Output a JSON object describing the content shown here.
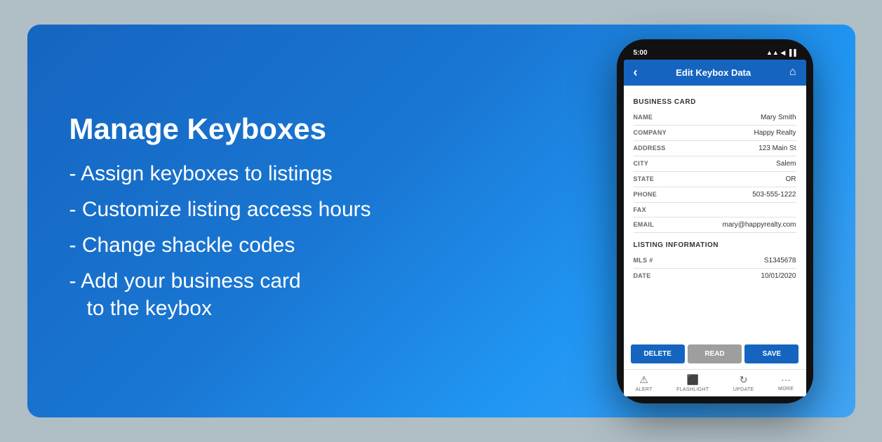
{
  "background": {
    "gradient_start": "#1565c0",
    "gradient_end": "#42a5f5"
  },
  "text_section": {
    "title": "Manage Keyboxes",
    "bullets": [
      "- Assign keyboxes to listings",
      "- Customize listing access hours",
      "- Change shackle codes",
      "- Add your business card\n    to the keybox"
    ]
  },
  "phone": {
    "status_bar": {
      "time": "5:00",
      "icons": "▲▲ ◀ ▐▐"
    },
    "header": {
      "back_icon": "‹",
      "title": "Edit Keybox Data",
      "home_icon": "⌂"
    },
    "business_card_section": {
      "label": "BUSINESS CARD",
      "fields": [
        {
          "label": "NAME",
          "value": "Mary Smith"
        },
        {
          "label": "COMPANY",
          "value": "Happy Realty"
        },
        {
          "label": "ADDRESS",
          "value": "123 Main St"
        },
        {
          "label": "CITY",
          "value": "Salem"
        },
        {
          "label": "STATE",
          "value": "OR"
        },
        {
          "label": "PHONE",
          "value": "503-555-1222"
        },
        {
          "label": "FAX",
          "value": ""
        },
        {
          "label": "EMAIL",
          "value": "mary@happyrealty.com"
        }
      ]
    },
    "listing_section": {
      "label": "LISTING INFORMATION",
      "fields": [
        {
          "label": "MLS #",
          "value": "S1345678"
        },
        {
          "label": "DATE",
          "value": "10/01/2020"
        }
      ]
    },
    "buttons": {
      "delete": "DELETE",
      "read": "READ",
      "save": "SAVE"
    },
    "bottom_nav": [
      {
        "icon": "⚠",
        "label": "ALERT"
      },
      {
        "icon": "⬛",
        "label": "FLASHLIGHT"
      },
      {
        "icon": "↻",
        "label": "UPDATE"
      },
      {
        "icon": "···",
        "label": "MORE"
      }
    ]
  }
}
